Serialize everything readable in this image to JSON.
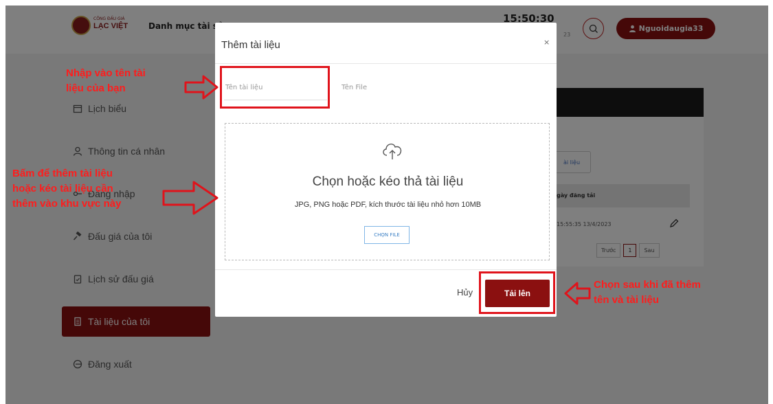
{
  "background": {
    "logo": {
      "line1": "CÔNG ĐẤU GIÁ",
      "line2": "LẠC VIỆT"
    },
    "nav_link": "Danh mục tài sả",
    "clock": "15:50:30",
    "date_fragment": "23",
    "user_button": "Nguoidaugia33",
    "sidebar": [
      {
        "label": "Lịch biểu",
        "icon": "calendar-icon"
      },
      {
        "label": "Thông tin cá nhân",
        "icon": "user-icon"
      },
      {
        "label": "Đăng nhập",
        "icon": "key-icon"
      },
      {
        "label": "Đấu giá của tôi",
        "icon": "gavel-icon"
      },
      {
        "label": "Lịch sử đấu giá",
        "icon": "clipboard-icon"
      },
      {
        "label": "Tài liệu của tôi",
        "icon": "document-icon",
        "active": true
      },
      {
        "label": "Đăng xuất",
        "icon": "logout-icon"
      }
    ],
    "content": {
      "doc_button": "ài liệu",
      "column_header": "gày đăng tải",
      "row_date": "15:55:35 13/4/2023",
      "pager_prev": "Trước",
      "pager_page": "1",
      "pager_next": "Sau"
    }
  },
  "modal": {
    "title": "Thêm tài liệu",
    "close": "×",
    "name_placeholder": "Tên tài liệu",
    "file_label": "Tên File",
    "dropzone_title": "Chọn hoặc kéo thả tài liệu",
    "dropzone_subtitle": "JPG, PNG hoặc PDF, kích thước tài liệu nhỏ hơn 10MB",
    "choose_file": "CHỌN FILE",
    "cancel": "Hủy",
    "upload": "Tải lên"
  },
  "annotations": {
    "note_name": [
      "Nhập vào tên tài",
      "liệu của bạn"
    ],
    "note_drop": [
      "Bấm để thêm tài liệu",
      "hoặc kéo tài liệu cần",
      "thêm vào khu vực này"
    ],
    "note_upload": [
      "Chọn sau khi đã thêm",
      "tên và tài liệu"
    ],
    "color": "#e0131b"
  }
}
